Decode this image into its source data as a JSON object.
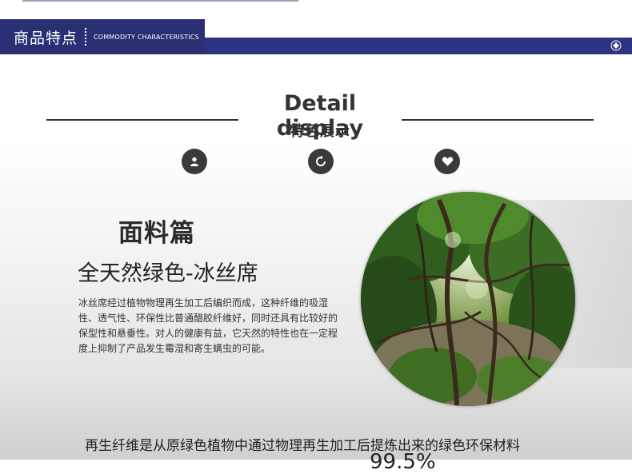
{
  "header": {
    "title": "商品特点",
    "subtitle": "COMMODITY CHARACTERISTICS"
  },
  "heading": {
    "title_en": "Detail display",
    "title_cn": "特色展示"
  },
  "icons": [
    "user-icon",
    "refresh-icon",
    "heart-icon"
  ],
  "section": {
    "title": "面料篇",
    "subtitle": "全天然绿色-冰丝席",
    "body": "冰丝席经过植物物理再生加工后编织而成，这种纤维的吸湿性、透气性、环保性比普通醋胶纤维好，同时还具有比较好的保型性和悬垂性。对人的健康有益，它天然的特性也在一定程度上抑制了产品发生霉湿和寄生螨虫的可能。"
  },
  "bottom": {
    "text": "再生纤维是从原绿色植物中通过物理再生加工后提炼出来的绿色环保材料",
    "number": "99.5%"
  },
  "colors": {
    "header_navy": "#2a2f74",
    "band_navy": "#2d3381",
    "icon_dark": "#3a3a3a"
  }
}
